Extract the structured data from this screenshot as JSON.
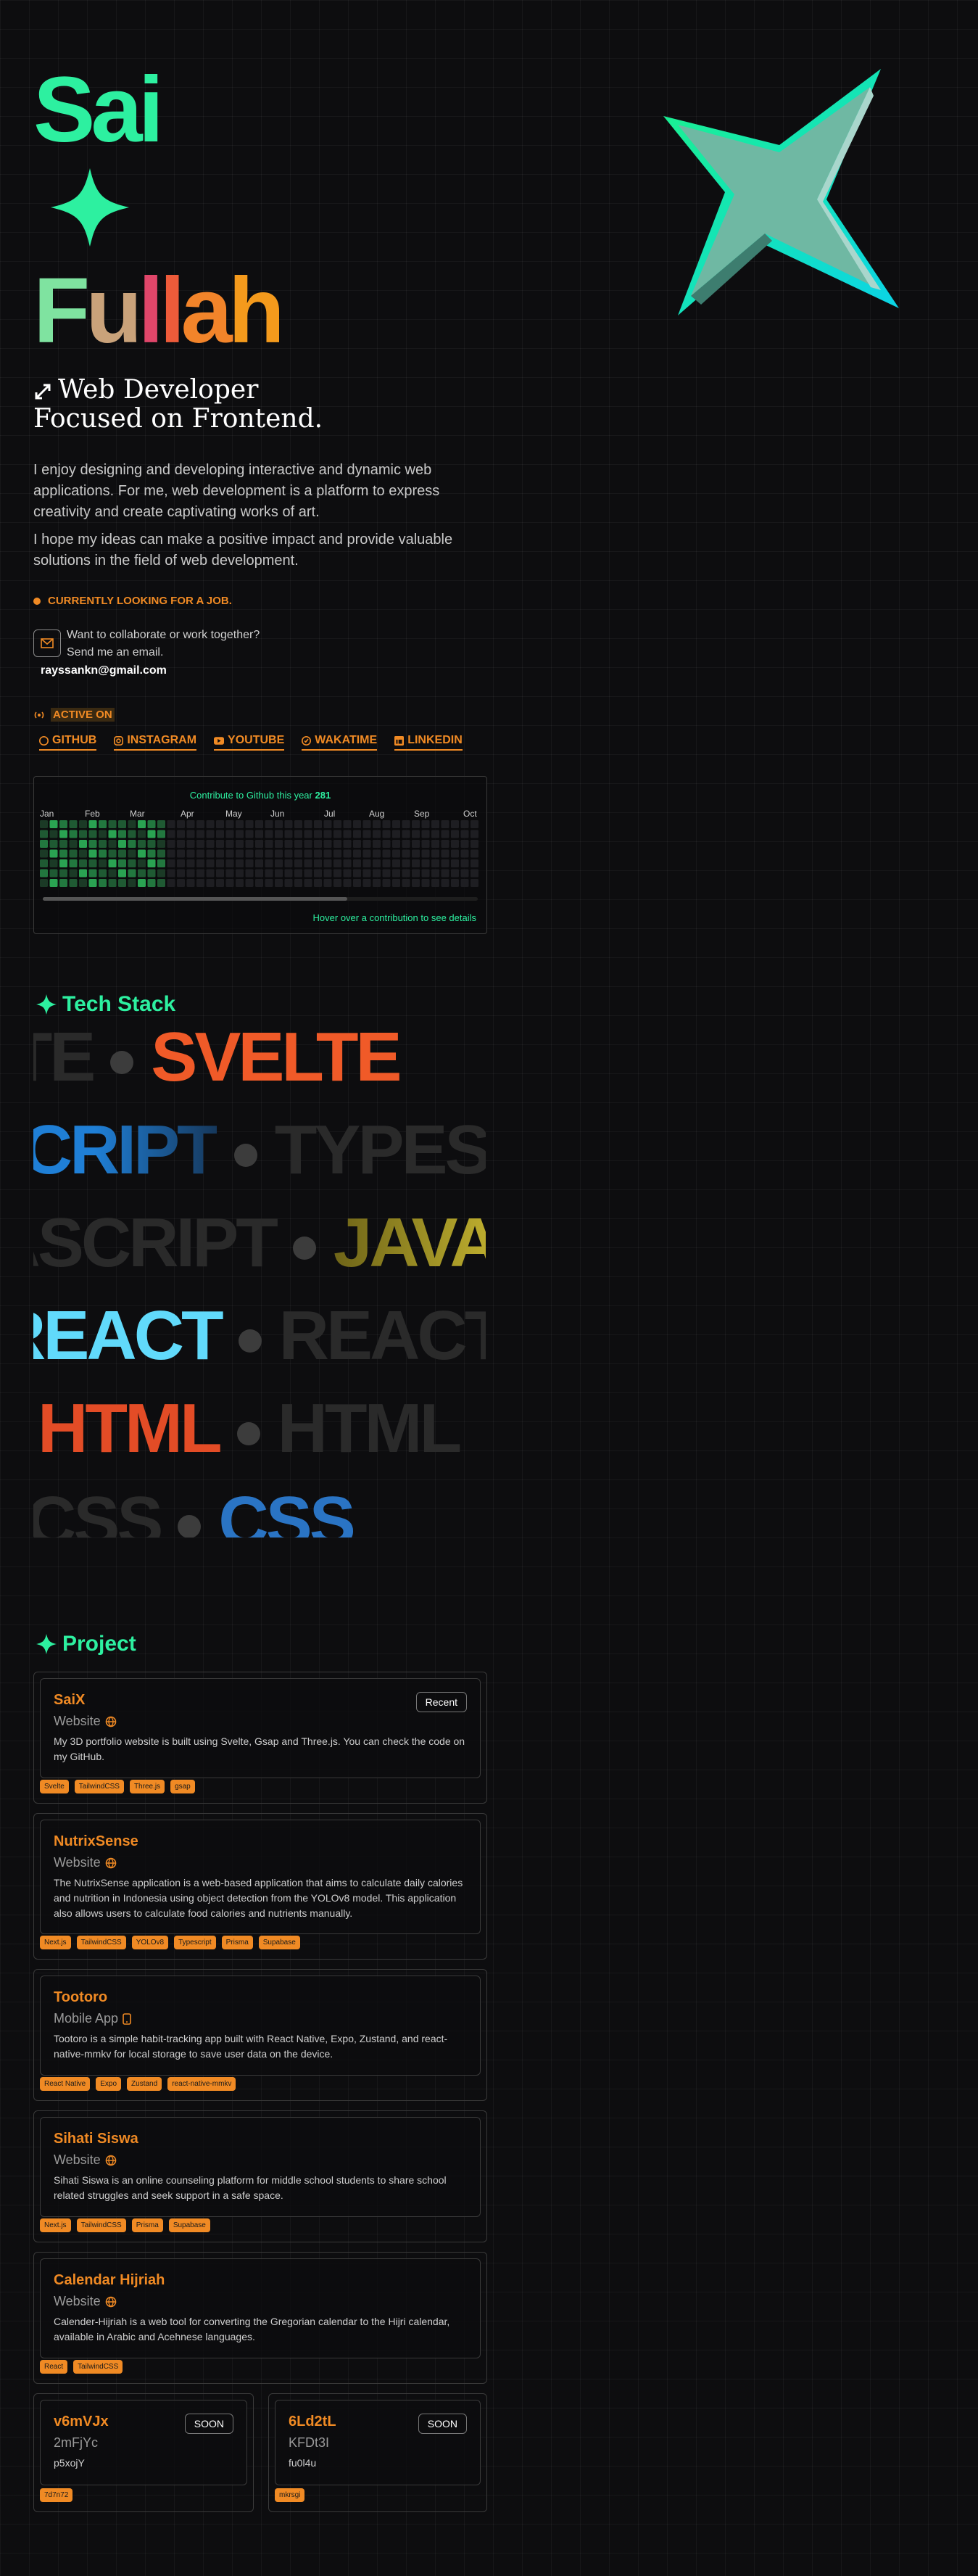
{
  "hero": {
    "first_name": "Sai",
    "last_name_letters": [
      "F",
      "u",
      "l",
      "l",
      "a",
      "h"
    ],
    "tagline_line1": "Web Developer",
    "tagline_line2": "Focused on Frontend.",
    "paragraph1": "I enjoy designing and developing interactive and dynamic web applications. For me, web development is a platform to express creativity and create captivating works of art.",
    "paragraph2": "I hope my ideas can make a positive impact and provide valuable solutions in the field of web development.",
    "looking": "CURRENTLY LOOKING FOR A JOB.",
    "collab_line1": "Want to collaborate or work together?",
    "collab_line2": "Send me an email.",
    "email": "rayssankn@gmail.com"
  },
  "colors": {
    "accent": "#2df0a0",
    "orange": "#f08a24",
    "background": "#0d0d0f"
  },
  "socials": {
    "title": "ACTIVE ON",
    "items": [
      {
        "label": "GITHUB",
        "icon": "github-icon"
      },
      {
        "label": "INSTAGRAM",
        "icon": "instagram-icon"
      },
      {
        "label": "YOUTUBE",
        "icon": "youtube-icon"
      },
      {
        "label": "WAKATIME",
        "icon": "wakatime-icon"
      },
      {
        "label": "LINKEDIN",
        "icon": "linkedin-icon"
      }
    ]
  },
  "github": {
    "title_prefix": "Contribute to Github this year",
    "count": "281",
    "months": [
      "Jan",
      "Feb",
      "Mar",
      "Apr",
      "May",
      "Jun",
      "Jul",
      "Aug",
      "Sep",
      "Oct"
    ],
    "hint": "Hover over a contribution to see details"
  },
  "tech": {
    "title": "Tech Stack",
    "rows": [
      {
        "words": [
          "SVELTE",
          "SVELTE",
          "SVELTE"
        ],
        "color": "#f05a28"
      },
      {
        "words": [
          "TYPESCRIPT",
          "TYPESCRIPT"
        ],
        "color": "#1f7fd6"
      },
      {
        "words": [
          "JAVASCRIPT",
          "JAVASCRIPT"
        ],
        "color": "#e8d53a"
      },
      {
        "words": [
          "REACT",
          "REACT"
        ],
        "color": "#61dafb"
      },
      {
        "words": [
          "HTML",
          "HTML"
        ],
        "color": "#e34c26"
      },
      {
        "words": [
          "CSS",
          "CSS"
        ],
        "color": "#2a74c4"
      }
    ]
  },
  "projects": {
    "title": "Project",
    "items": [
      {
        "title": "SaiX",
        "type": "Website",
        "badge": "Recent",
        "desc": "My 3D portfolio website is built using Svelte, Gsap and Three.js. You can check the code on my GitHub.",
        "tags": [
          "Svelte",
          "TailwindCSS",
          "Three.js",
          "gsap"
        ]
      },
      {
        "title": "NutrixSense",
        "type": "Website",
        "badge": "",
        "desc": "The NutrixSense application is a web-based application that aims to calculate daily calories and nutrition in Indonesia using object detection from the YOLOv8 model. This application also allows users to calculate food calories and nutrients manually.",
        "tags": [
          "Next.js",
          "TailwindCSS",
          "YOLOv8",
          "Typescript",
          "Prisma",
          "Supabase"
        ]
      },
      {
        "title": "Tootoro",
        "type": "Mobile App",
        "badge": "",
        "desc": "Tootoro is a simple habit-tracking app built with React Native, Expo, Zustand, and react-native-mmkv for local storage to save user data on the device.",
        "tags": [
          "React Native",
          "Expo",
          "Zustand",
          "react-native-mmkv"
        ]
      },
      {
        "title": "Sihati Siswa",
        "type": "Website",
        "badge": "",
        "desc": "Sihati Siswa is an online counseling platform for middle school students to share school related struggles and seek support in a safe space.",
        "tags": [
          "Next.js",
          "TailwindCSS",
          "Prisma",
          "Supabase"
        ]
      },
      {
        "title": "Calendar Hijriah",
        "type": "Website",
        "badge": "",
        "desc": "Calender-Hijriah is a web tool for converting the Gregorian calendar to the Hijri calendar, available in Arabic and Acehnese languages.",
        "tags": [
          "React",
          "TailwindCSS"
        ]
      },
      {
        "title": "v6mVJx",
        "type": "2mFjYc",
        "badge": "SOON",
        "desc": "p5xojY",
        "tags": [
          "7d7n72"
        ]
      },
      {
        "title": "6Ld2tL",
        "type": "KFDt3I",
        "badge": "SOON",
        "desc": "fu0l4u",
        "tags": [
          "mkrsgi"
        ]
      }
    ]
  }
}
